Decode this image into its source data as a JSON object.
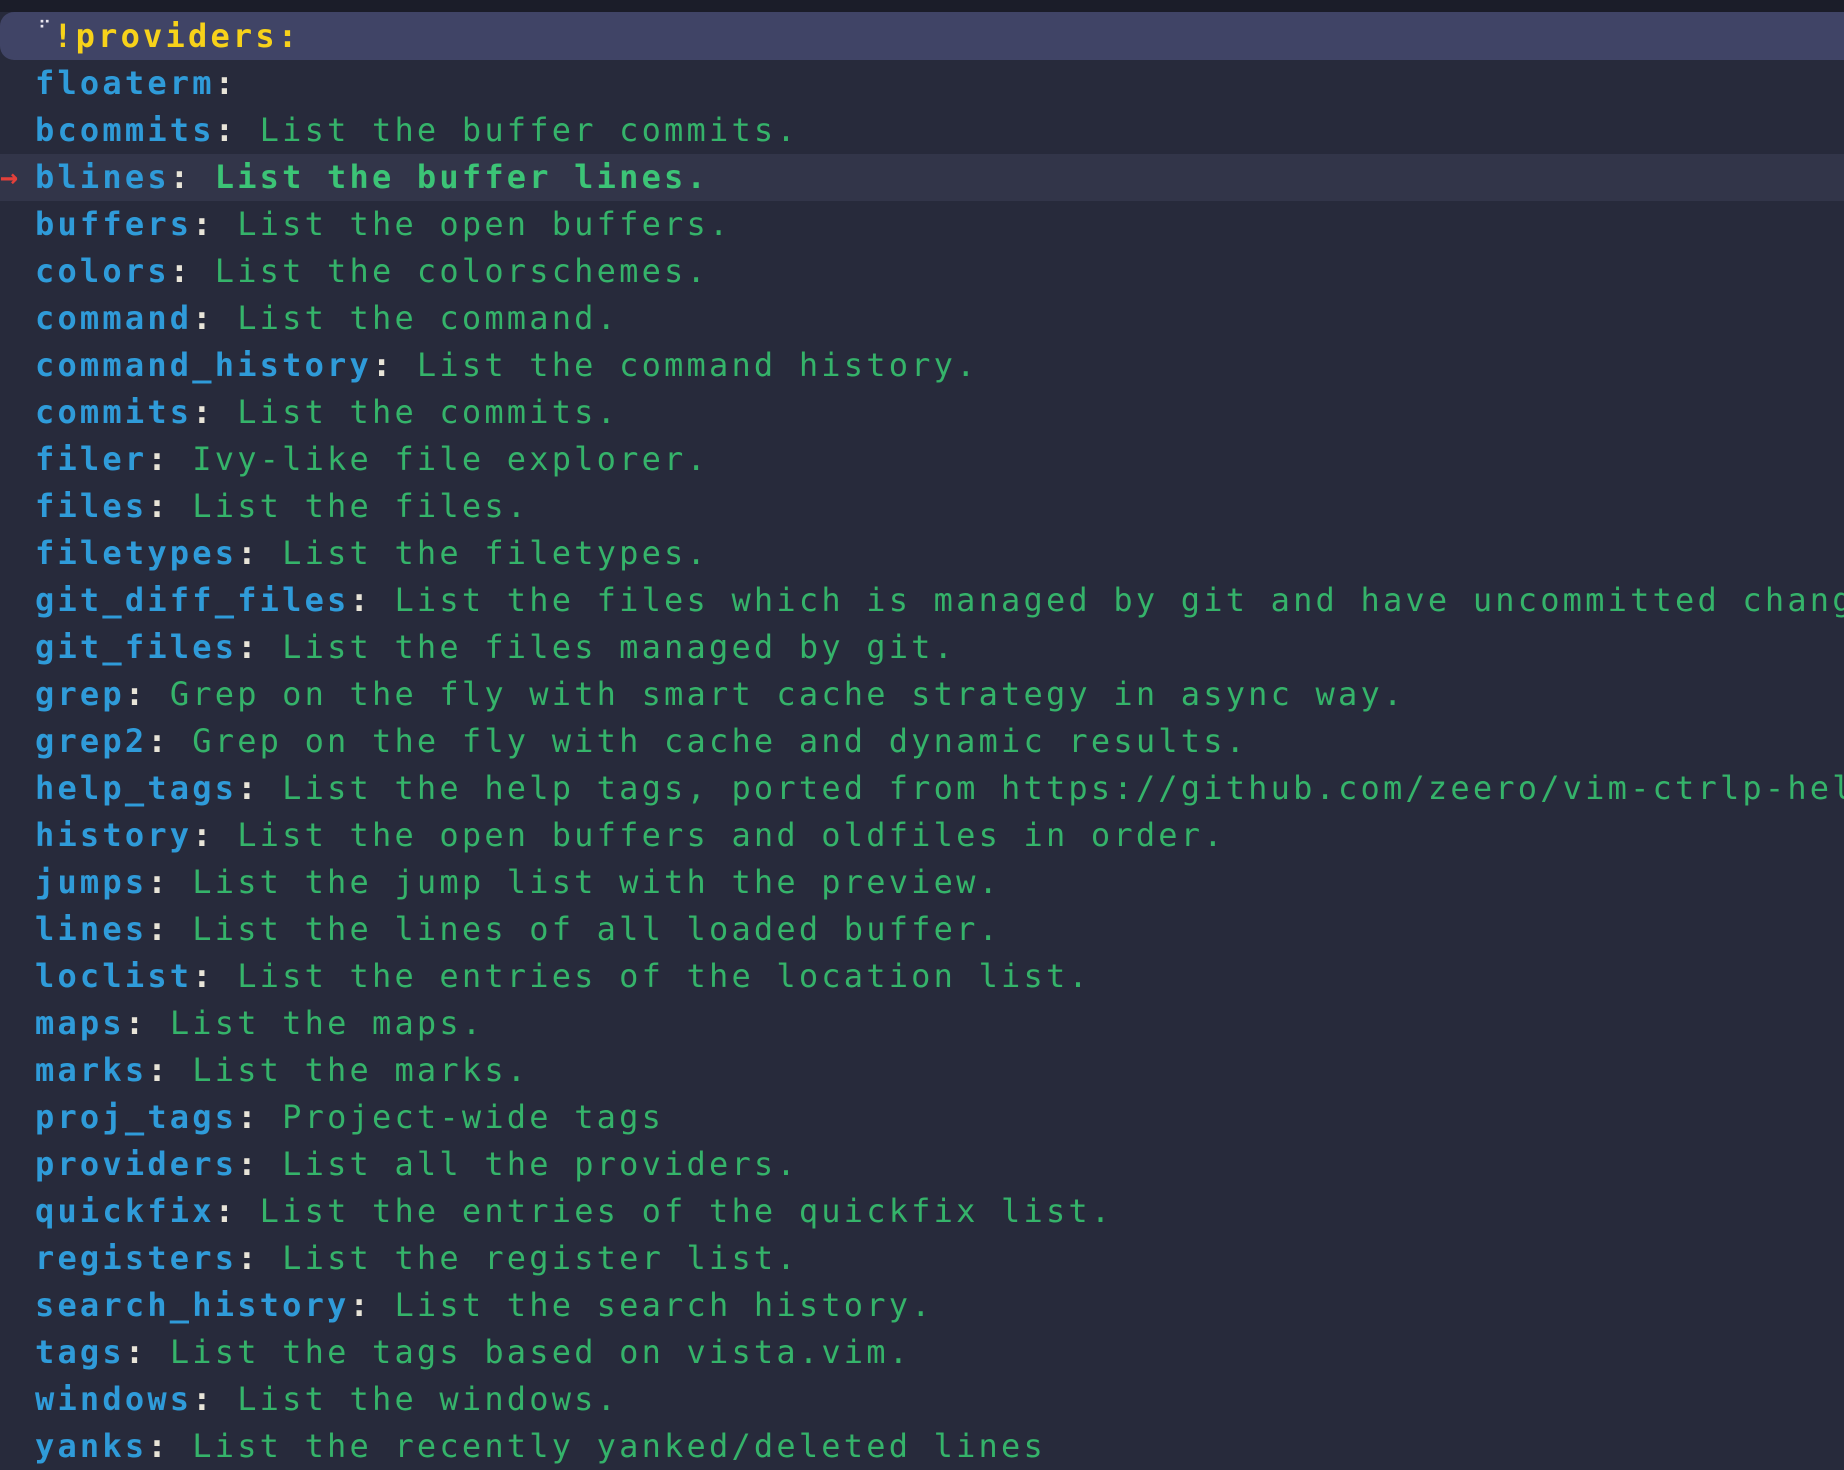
{
  "prompt": {
    "icon": "⠋",
    "query": "!providers:"
  },
  "selected_index": 2,
  "caret_glyph": "→",
  "colon": ":",
  "items": [
    {
      "key": "floaterm",
      "desc": ""
    },
    {
      "key": "bcommits",
      "desc": "List the buffer commits."
    },
    {
      "key": "blines",
      "desc": "List the buffer lines."
    },
    {
      "key": "buffers",
      "desc": "List the open buffers."
    },
    {
      "key": "colors",
      "desc": "List the colorschemes."
    },
    {
      "key": "command",
      "desc": "List the command."
    },
    {
      "key": "command_history",
      "desc": "List the command history."
    },
    {
      "key": "commits",
      "desc": "List the commits."
    },
    {
      "key": "filer",
      "desc": "Ivy-like file explorer."
    },
    {
      "key": "files",
      "desc": "List the files."
    },
    {
      "key": "filetypes",
      "desc": "List the filetypes."
    },
    {
      "key": "git_diff_files",
      "desc": "List the files which is managed by git and have uncommitted changes."
    },
    {
      "key": "git_files",
      "desc": "List the files managed by git."
    },
    {
      "key": "grep",
      "desc": "Grep on the fly with smart cache strategy in async way."
    },
    {
      "key": "grep2",
      "desc": "Grep on the fly with cache and dynamic results."
    },
    {
      "key": "help_tags",
      "desc": "List the help tags, ported from https://github.com/zeero/vim-ctrlp-help"
    },
    {
      "key": "history",
      "desc": "List the open buffers and oldfiles in order."
    },
    {
      "key": "jumps",
      "desc": "List the jump list with the preview."
    },
    {
      "key": "lines",
      "desc": "List the lines of all loaded buffer."
    },
    {
      "key": "loclist",
      "desc": "List the entries of the location list."
    },
    {
      "key": "maps",
      "desc": "List the maps."
    },
    {
      "key": "marks",
      "desc": "List the marks."
    },
    {
      "key": "proj_tags",
      "desc": "Project-wide tags"
    },
    {
      "key": "providers",
      "desc": "List all the providers."
    },
    {
      "key": "quickfix",
      "desc": "List the entries of the quickfix list."
    },
    {
      "key": "registers",
      "desc": "List the register list."
    },
    {
      "key": "search_history",
      "desc": "List the search history."
    },
    {
      "key": "tags",
      "desc": "List the tags based on vista.vim."
    },
    {
      "key": "windows",
      "desc": "List the windows."
    },
    {
      "key": "yanks",
      "desc": "List the recently yanked/deleted lines"
    }
  ],
  "colors": {
    "background": "#272a3b",
    "prompt_bar": "#404466",
    "prompt_text": "#f7d21a",
    "key": "#2f9bd9",
    "description": "#35b36a",
    "selected_row": "#323549",
    "caret": "#e3403a"
  }
}
